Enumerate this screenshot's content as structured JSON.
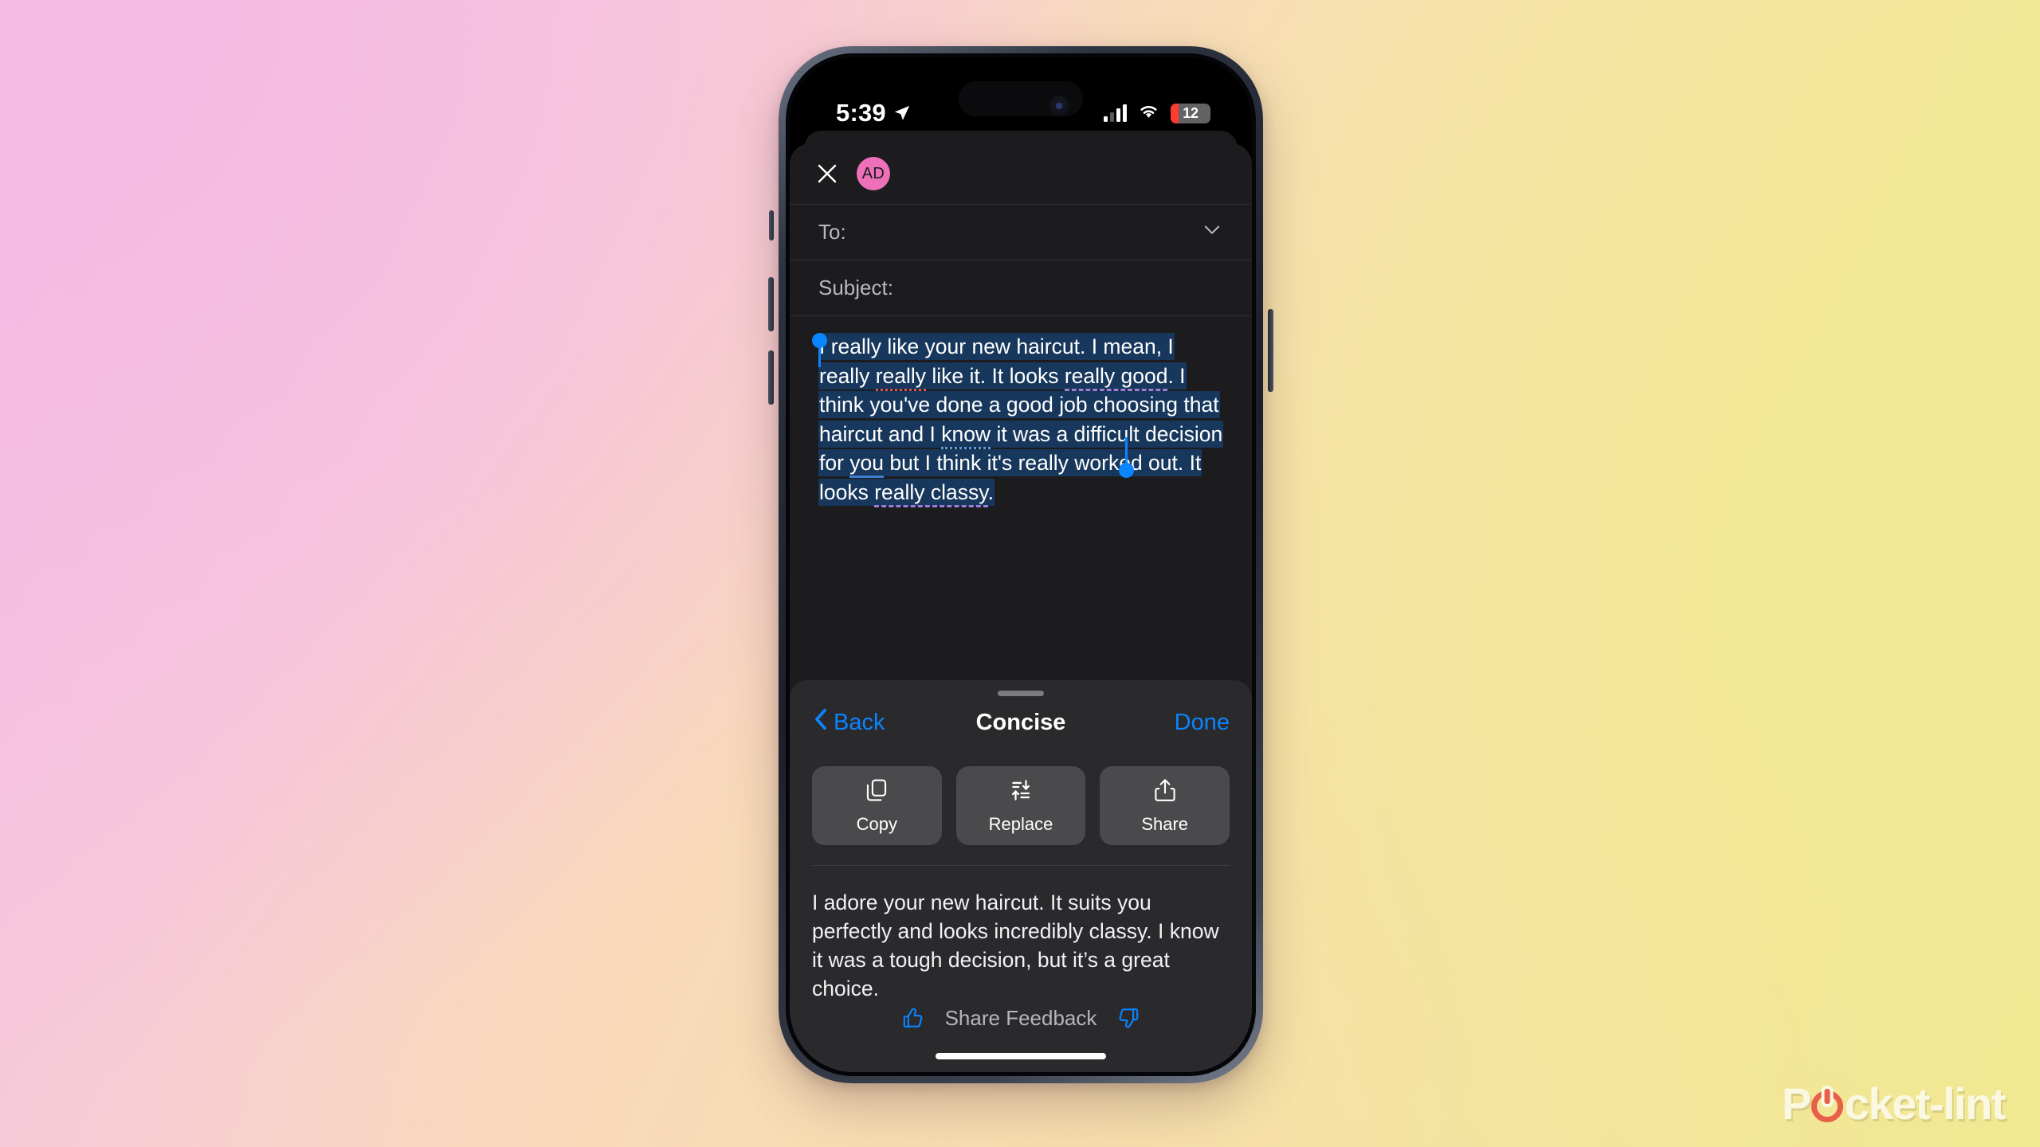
{
  "background": {
    "gradient_from": "#f4bde6",
    "gradient_mid": "#f8ddb9",
    "gradient_to": "#eee88f"
  },
  "status_bar": {
    "time": "5:39",
    "location_icon": "location-arrow-icon",
    "signal_icon": "cellular-signal-icon",
    "wifi_icon": "wifi-icon",
    "battery_percent": "12",
    "battery_color": "#ff3b30"
  },
  "compose": {
    "close_icon": "close-icon",
    "avatar_initials": "AD",
    "avatar_color": "#ee70b9",
    "to_label": "To:",
    "to_value": "",
    "recipients_expand_icon": "chevron-down-icon",
    "subject_label": "Subject:",
    "subject_value": "",
    "body_text": "I really like your new haircut. I mean, I really really like it. It looks really good. I think you've done a good job choosing that haircut and I know it was a difficult decision for you but I think it's really worked out. It looks really classy.",
    "body_segments": [
      {
        "text": "I really like your new haircut. I mean, I really ",
        "mark": "none"
      },
      {
        "text": "really",
        "mark": "spelling-red"
      },
      {
        "text": " like it. It looks ",
        "mark": "none"
      },
      {
        "text": "really good",
        "mark": "grammar-purple"
      },
      {
        "text": ". I think you've done a good job choosing that haircut and I ",
        "mark": "none"
      },
      {
        "text": "know",
        "mark": "hint-blue-dotted"
      },
      {
        "text": " it was a difficult decision for ",
        "mark": "none"
      },
      {
        "text": "you",
        "mark": "link-blue"
      },
      {
        "text": " but I think it's really worked out. It looks ",
        "mark": "none"
      },
      {
        "text": "really classy",
        "mark": "grammar-purple"
      },
      {
        "text": ".",
        "mark": "none"
      }
    ],
    "selection_color": "#17385c",
    "selection_handle_color": "#0a84ff",
    "toolbar": [
      {
        "name": "add-attachment-button",
        "icon": "plus-circle-icon",
        "accent": "#0a84ff"
      },
      {
        "name": "attach-file-button",
        "icon": "paperclip-icon"
      },
      {
        "name": "take-photo-button",
        "icon": "camera-icon"
      },
      {
        "name": "markup-button",
        "icon": "markup-pen-icon"
      },
      {
        "name": "add-document-button",
        "icon": "add-document-icon"
      },
      {
        "name": "verified-contact-button",
        "icon": "person-check-icon"
      },
      {
        "name": "send-later-button",
        "icon": "send-later-icon"
      },
      {
        "name": "send-button",
        "icon": "send-icon"
      }
    ]
  },
  "writing_tools": {
    "back_label": "Back",
    "back_icon": "chevron-left-icon",
    "title": "Concise",
    "done_label": "Done",
    "accent_color": "#0a84ff",
    "actions": [
      {
        "label": "Copy",
        "icon": "copy-icon"
      },
      {
        "label": "Replace",
        "icon": "replace-icon"
      },
      {
        "label": "Share",
        "icon": "share-icon"
      }
    ],
    "result_text": "I adore your new haircut. It suits you perfectly and looks incredibly classy. I know it was a tough decision, but it’s a great choice.",
    "feedback": {
      "thumbs_up_icon": "thumbs-up-icon",
      "label": "Share Feedback",
      "thumbs_down_icon": "thumbs-down-icon"
    }
  },
  "watermark": {
    "text_before": "P",
    "text_after": "cket-lint",
    "power_icon": "power-icon",
    "power_color": "#e8604a",
    "text_color": "#fbf8e2"
  }
}
